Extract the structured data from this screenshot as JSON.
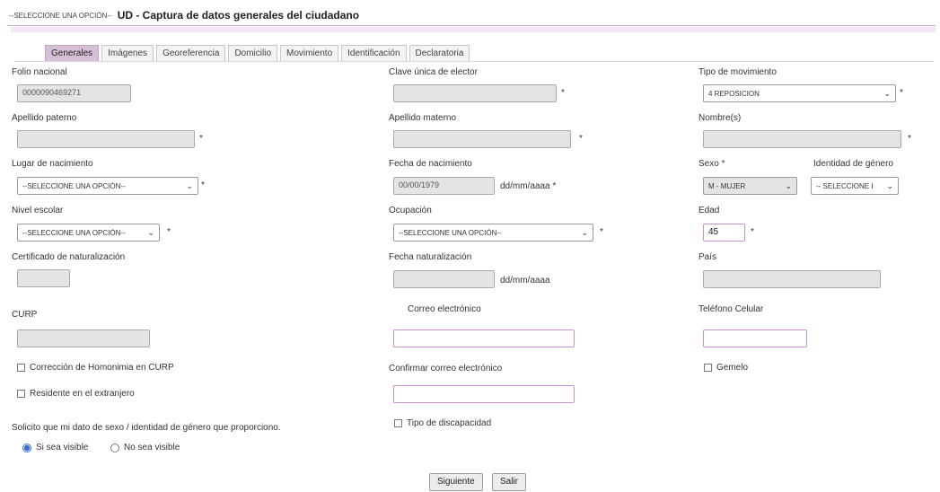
{
  "header": {
    "selector": "--SELECCIONE UNA OPCIÓN--",
    "title": "UD - Captura de datos generales del ciudadano"
  },
  "tabs": [
    "Generales",
    "Imágenes",
    "Georeferencia",
    "Domicilio",
    "Movimiento",
    "Identificación",
    "Declaratoria"
  ],
  "labels": {
    "folio": "Folio nacional",
    "clave": "Clave única de elector",
    "tipo_mov": "Tipo de movimiento",
    "ap_paterno": "Apellido paterno",
    "ap_materno": "Apellido materno",
    "nombres": "Nombre(s)",
    "lugar_nac": "Lugar de nacimiento",
    "fecha_nac": "Fecha de nacimiento",
    "sexo": "Sexo *",
    "identidad": "Identidad de género",
    "nivel": "Nivel escolar",
    "ocupacion": "Ocupación",
    "edad": "Edad",
    "certificado": "Certificado de naturalización",
    "fecha_nat": "Fecha naturalización",
    "pais": "País",
    "curp": "CURP",
    "correo": "Correo electrónico",
    "telefono": "Teléfono Celular",
    "confirmar": "Confirmar correo electrónico",
    "fecha_fmt": "dd/mm/aaaa *",
    "fecha_fmt2": "dd/mm/aaaa",
    "star": "*"
  },
  "values": {
    "folio": "0000090469271",
    "tipo_mov": "4 REPOSICION",
    "lugar_nac": "--SELECCIONE UNA OPCIÓN--",
    "fecha_nac": "00/00/1979",
    "sexo": "M - MUJER",
    "identidad": "-- SELECCIONE I",
    "nivel": "--SELECCIONE UNA OPCIÓN--",
    "ocupacion": "--SELECCIONE UNA OPCIÓN--",
    "edad": "45"
  },
  "checkboxes": {
    "homonimia": "Corrección de Homonimia en CURP",
    "residente": "Residente en el extranjero",
    "gemelo": "Gemelo",
    "discapacidad": "Tipo de discapacidad"
  },
  "visibility": {
    "prompt": "Solicito que mi dato de sexo / identidad de género que proporciono.",
    "yes": "Si sea visible",
    "no": "No sea visible"
  },
  "buttons": {
    "next": "Siguiente",
    "exit": "Salir"
  }
}
